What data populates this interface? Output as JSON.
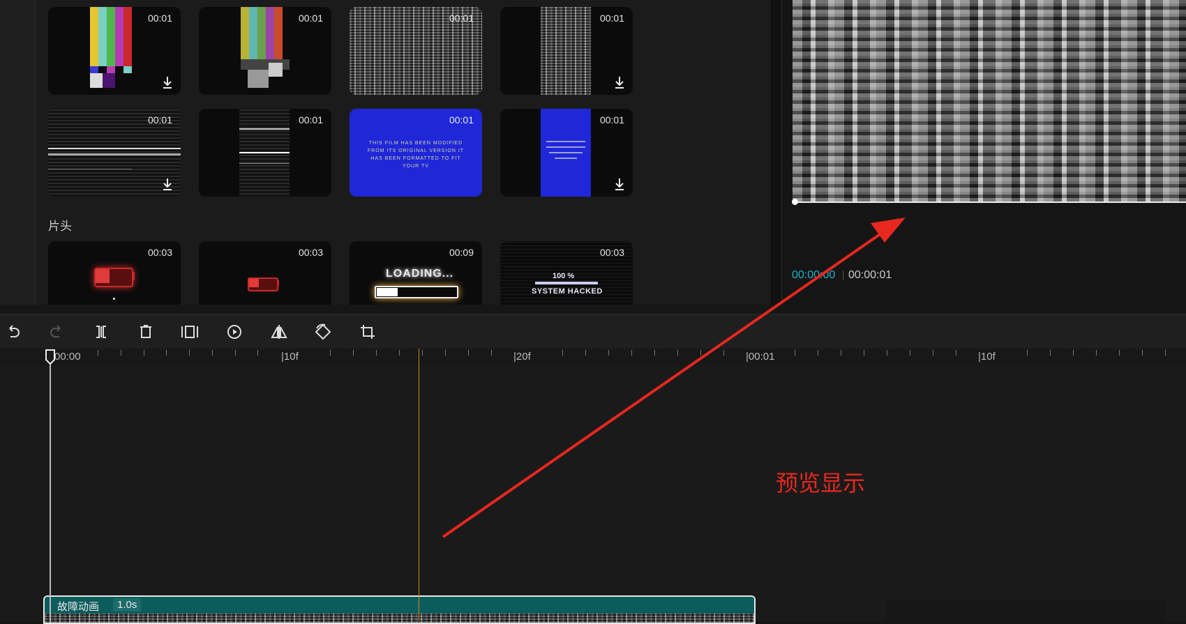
{
  "library": {
    "row1": [
      {
        "duration": "00:01",
        "art": "color-bars-icon"
      },
      {
        "duration": "00:01",
        "art": "color-bars-glitch-icon"
      },
      {
        "duration": "00:01",
        "art": "static-noise-icon"
      },
      {
        "duration": "00:01",
        "art": "static-noise-narrow-icon"
      }
    ],
    "row2": [
      {
        "duration": "00:01",
        "art": "scanline-glitch-icon"
      },
      {
        "duration": "00:01",
        "art": "scanline-narrow-icon"
      },
      {
        "duration": "00:01",
        "art": "blue-screen-icon",
        "text": "THIS FILM HAS BEEN MODIFIED FROM ITS ORIGINAL VERSION IT HAS BEEN FORMATTED TO FIT YOUR TV"
      },
      {
        "duration": "00:01",
        "art": "blue-screen-narrow-icon"
      }
    ],
    "section_title": "片头",
    "row3": [
      {
        "duration": "00:03",
        "art": "battery-low-icon"
      },
      {
        "duration": "00:03",
        "art": "battery-low-small-icon"
      },
      {
        "duration": "00:09",
        "art": "loading-bar-icon",
        "text": "LOADING..."
      },
      {
        "duration": "00:03",
        "art": "system-hacked-icon",
        "text": "100 %",
        "text2": "SYSTEM HACKED"
      }
    ]
  },
  "preview": {
    "current_time": "00:00:00",
    "total_time": "00:00:01",
    "accent": "#1fb5c9"
  },
  "toolbar": {
    "tools": [
      "undo-icon",
      "redo-icon",
      "split-icon",
      "delete-icon",
      "freeze-icon",
      "reverse-icon",
      "mirror-icon",
      "rotate-icon",
      "crop-icon"
    ]
  },
  "ruler": {
    "labels": [
      "00:00",
      "|10f",
      "|20f",
      "|00:01",
      "|10f"
    ]
  },
  "timeline": {
    "clip_name": "故障动画",
    "clip_duration": "1.0s",
    "clip_color": "#0d5c5c"
  },
  "annotation": {
    "text": "预览显示",
    "color": "#e8281f"
  }
}
